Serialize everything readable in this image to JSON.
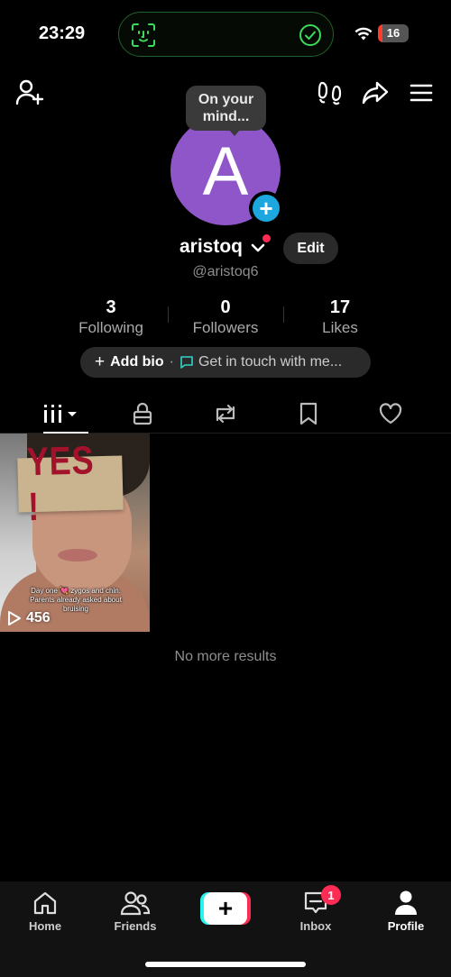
{
  "status_bar": {
    "time": "23:29",
    "battery": "16",
    "battery_level_fraction": 0.16
  },
  "profile": {
    "avatar_letter": "A",
    "bubble_text": "On your mind...",
    "username": "aristoq",
    "handle": "@aristoq6",
    "edit_label": "Edit",
    "stats": [
      {
        "value": "3",
        "label": "Following"
      },
      {
        "value": "0",
        "label": "Followers"
      },
      {
        "value": "17",
        "label": "Likes"
      }
    ],
    "bio": {
      "add_label": "Add bio",
      "separator": "·",
      "contact_label": "Get in touch with me..."
    }
  },
  "video": {
    "sign_text": "YES !",
    "caption": "Day one 💘 zygos and chin. Parents already asked about bruising",
    "views": "456"
  },
  "no_more_results": "No more results",
  "nav": {
    "home": "Home",
    "friends": "Friends",
    "create": "+",
    "inbox": "Inbox",
    "inbox_badge": "1",
    "profile": "Profile"
  },
  "colors": {
    "accent": "#fe2c55",
    "avatar": "#8e56c8",
    "add_button": "#1da7df",
    "cyan": "#25f4ee"
  },
  "icons": [
    "face-id-icon",
    "check-icon",
    "wifi-icon",
    "add-friend-icon",
    "footprint-icon",
    "share-icon",
    "menu-icon",
    "chevron-down-icon",
    "chat-icon",
    "grid-icon",
    "lock-icon",
    "repost-icon",
    "bookmark-icon",
    "heart-icon",
    "play-icon",
    "home-icon",
    "friends-icon",
    "inbox-icon",
    "profile-icon"
  ]
}
